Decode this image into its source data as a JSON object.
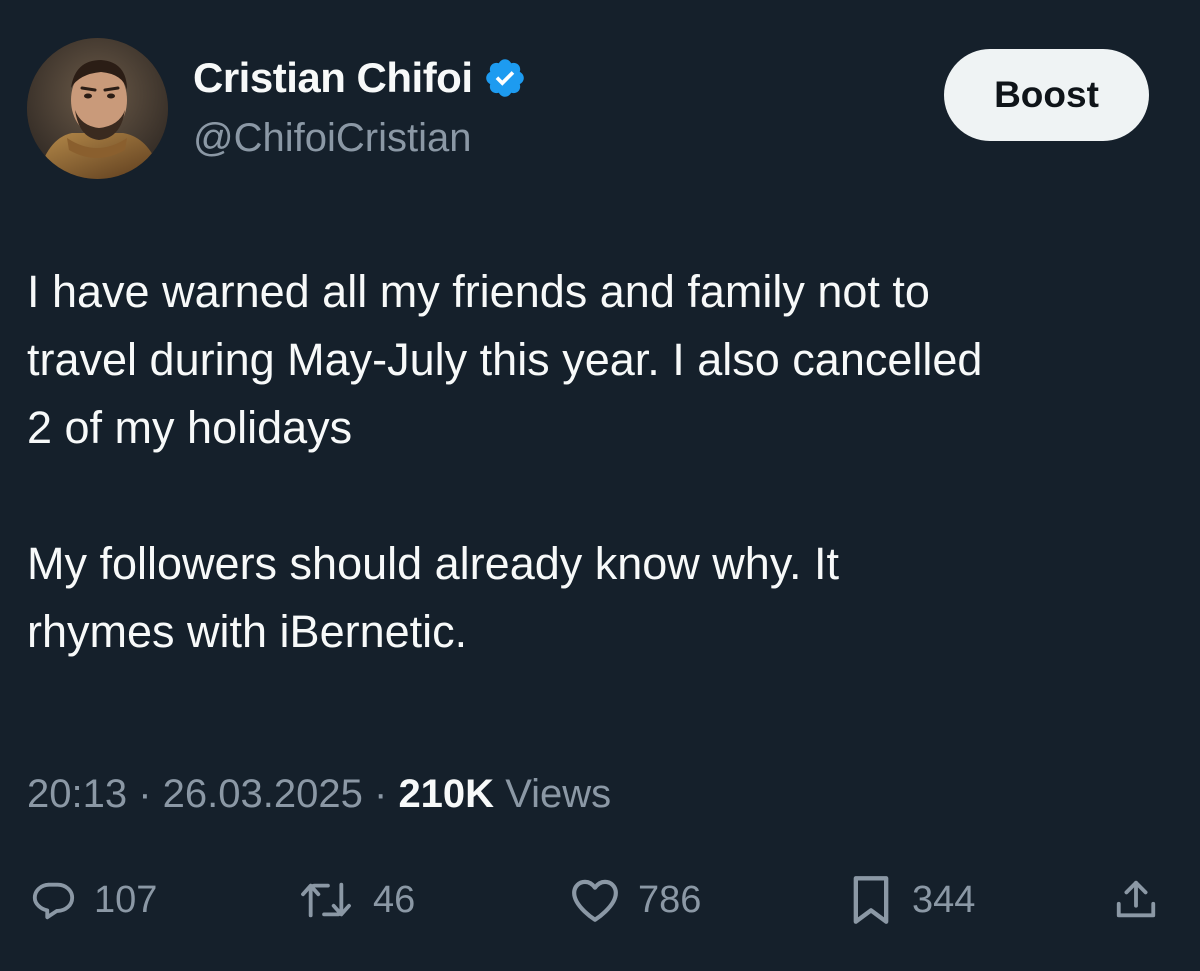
{
  "author": {
    "display_name": "Cristian Chifoi",
    "handle": "@ChifoiCristian",
    "verified": true,
    "verified_color": "#1d9bf0"
  },
  "header": {
    "boost_label": "Boost"
  },
  "tweet": {
    "paragraphs": [
      [
        "I have warned all my friends and family not to",
        "travel during May-July this year. I also cancelled",
        "2 of my holidays"
      ],
      [
        "My followers should already know why. It",
        "rhymes with iBernetic."
      ]
    ],
    "time": "20:13",
    "date": "26.03.2025",
    "views_count": "210K",
    "views_label": "Views"
  },
  "actions": {
    "replies": "107",
    "reposts": "46",
    "likes": "786",
    "bookmarks": "344"
  },
  "colors": {
    "background": "#15202b",
    "text_primary": "#f7f9f9",
    "text_secondary": "#8b98a5",
    "button_bg": "#eff3f4"
  },
  "icons": [
    "verified-badge-icon",
    "reply-icon",
    "repost-icon",
    "like-icon",
    "bookmark-icon",
    "share-icon"
  ]
}
